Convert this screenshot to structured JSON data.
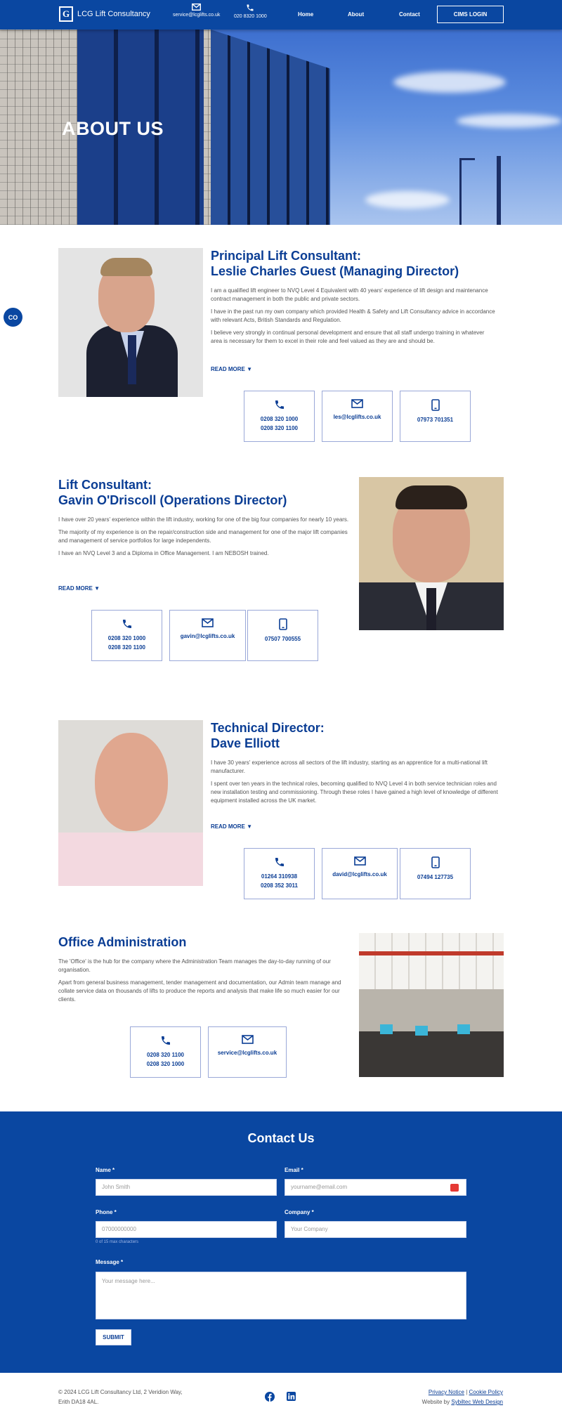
{
  "header": {
    "logo_text": "LCG Lift Consultancy",
    "email": "service@lcglifts.co.uk",
    "phone": "020 8320 1000",
    "nav": [
      "Home",
      "About",
      "Contact"
    ],
    "cims_label": "CIMS LOGIN"
  },
  "hero": {
    "title": "ABOUT US"
  },
  "side_badge": "CO",
  "people": [
    {
      "role": "Principal Lift Consultant:",
      "name": "Leslie Charles Guest (Managing Director)",
      "paragraphs": [
        "I am a qualified lift engineer to NVQ Level 4 Equivalent with 40 years' experience of lift design and maintenance contract management in both the public and private sectors.",
        "I have in the past run my own company which provided Health & Safety and Lift Consultancy advice in accordance with relevant Acts, British Standards and Regulation.",
        "I believe very strongly in continual personal development and ensure that all staff undergo training in whatever area is necessary for them to excel in their role and feel valued as they are and should be."
      ],
      "read_more": "READ MORE",
      "phones": [
        "0208 320 1000",
        "0208 320 1100"
      ],
      "email": "les@lcglifts.co.uk",
      "mobile": "07973 701351"
    },
    {
      "role": "Lift Consultant:",
      "name": "Gavin O'Driscoll (Operations Director)",
      "paragraphs": [
        "I have over 20 years' experience within the lift industry, working for one of the big four companies for nearly 10 years.",
        "The majority of my experience is on the repair/construction side and management for one of the major lift companies and management of service portfolios for large independents.",
        "I have an NVQ Level 3 and a Diploma in Office Management. I am NEBOSH trained."
      ],
      "read_more": "READ MORE",
      "phones": [
        "0208 320 1000",
        "0208 320 1100"
      ],
      "email": "gavin@lcglifts.co.uk",
      "mobile": "07507 700555"
    },
    {
      "role": "Technical Director:",
      "name": "Dave Elliott",
      "paragraphs": [
        "I have 30 years' experience across all sectors of the lift industry, starting as an apprentice for a multi-national lift manufacturer.",
        "I spent over ten years in the technical roles, becoming qualified to NVQ Level 4 in both service technician roles and new installation testing and commissioning. Through these roles I have gained a high level of knowledge of different equipment installed across the UK market."
      ],
      "read_more": "READ MORE",
      "phones": [
        "01264 310938",
        "0208 352 3011"
      ],
      "email": "david@lcglifts.co.uk",
      "mobile": "07494 127735"
    }
  ],
  "office": {
    "title": "Office Administration",
    "paragraphs": [
      "The 'Office' is the hub for the company where the Administration Team manages the day-to-day running of our organisation.",
      "Apart from general business management, tender management and documentation, our Admin team manage and collate service data on thousands of lifts to produce the reports and analysis that make life so much easier for our clients."
    ],
    "phones": [
      "0208 320 1100",
      "0208 320 1000"
    ],
    "email": "service@lcglifts.co.uk"
  },
  "contact": {
    "title": "Contact Us",
    "name_label": "Name *",
    "name_placeholder": "John Smith",
    "email_label": "Email *",
    "email_placeholder": "yourname@email.com",
    "phone_label": "Phone *",
    "phone_placeholder": "07000000000",
    "phone_hint": "0 of 15 max characters",
    "company_label": "Company *",
    "company_placeholder": "Your Company",
    "message_label": "Message *",
    "message_placeholder": "Your message here...",
    "submit_label": "SUBMIT"
  },
  "footer": {
    "copyright": "© 2024 LCG Lift Consultancy Ltd, 2 Veridion Way,",
    "address2": "Erith DA18 4AL.",
    "privacy": "Privacy Notice",
    "separator": "|",
    "cookie": "Cookie Policy",
    "website_by": "Website by",
    "designer": "Sybiltec Web Design"
  },
  "colors": {
    "brand": "#0a47a1",
    "heading": "#0a3d94"
  }
}
